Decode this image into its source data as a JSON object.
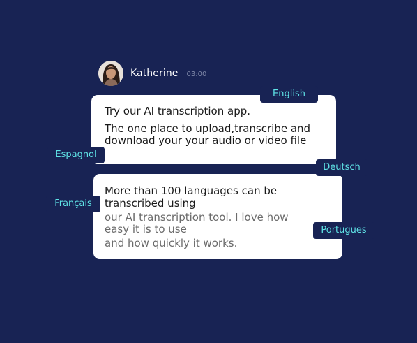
{
  "user": {
    "name": "Katherine",
    "time": "03:00"
  },
  "bubble1": {
    "line1": "Try our AI transcription app.",
    "line2": "The one place to upload,transcribe and",
    "line3": "download your your audio or video file"
  },
  "bubble2": {
    "line1": "More than 100 languages can be",
    "line2": "transcribed using",
    "line3": "our AI transcription tool. I love how",
    "line4": "easy it is to use",
    "line5": "and how quickly it works."
  },
  "languages": {
    "english": "English",
    "espagnol": "Espagnol",
    "deutsch": "Deutsch",
    "francais": "Français",
    "portugues": "Portugues"
  },
  "colors": {
    "background": "#182354",
    "tag_text": "#5fe3e6",
    "bubble": "#ffffff"
  },
  "icons": {
    "avatar": "user-avatar-photo"
  }
}
